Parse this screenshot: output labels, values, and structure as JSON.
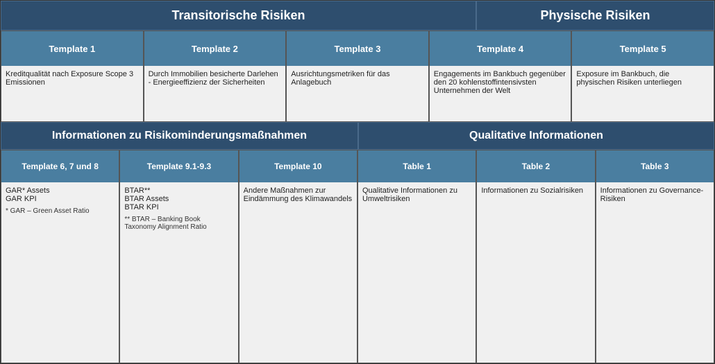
{
  "header": {
    "transitorische": "Transitorische Risiken",
    "physische": "Physische Risiken"
  },
  "templates": [
    {
      "label": "Template 1",
      "body": "Kreditqualität nach Exposure Scope 3 Emissionen"
    },
    {
      "label": "Template 2",
      "body": "Durch Immobilien besicherte Darlehen - Energieeffizienz der Sicherheiten"
    },
    {
      "label": "Template 3",
      "body": "Ausrichtungsmetriken für das Anlagebuch"
    },
    {
      "label": "Template 4",
      "body": "Engagements im Bankbuch gegenüber den 20 kohlenstoffintensivsten Unternehmen der Welt"
    },
    {
      "label": "Template 5",
      "body": "Exposure im Bankbuch, die physischen Risiken unterliegen"
    }
  ],
  "sections": {
    "risiko": "Informationen zu Risikominderungsmaßnahmen",
    "qualitative": "Qualitative Informationen"
  },
  "bottom_templates": [
    {
      "label": "Template 6, 7 und 8",
      "body": "GAR* Assets\nGAR KPI",
      "footnote": "* GAR – Green Asset Ratio"
    },
    {
      "label": "Template 9.1-9.3",
      "body": "BTAR**\nBTAR Assets\nBTAR KPI",
      "footnote": "** BTAR – Banking Book Taxonomy Alignment Ratio"
    },
    {
      "label": "Template 10",
      "body": "Andere Maßnahmen zur Eindämmung des Klimawandels",
      "footnote": ""
    },
    {
      "label": "Table 1",
      "body": "Qualitative Informationen zu Umweltrisiken",
      "footnote": ""
    },
    {
      "label": "Table 2",
      "body": "Informationen zu Sozialrisiken",
      "footnote": ""
    },
    {
      "label": "Table 3",
      "body": "Informationen zu Governance-Risiken",
      "footnote": ""
    }
  ]
}
